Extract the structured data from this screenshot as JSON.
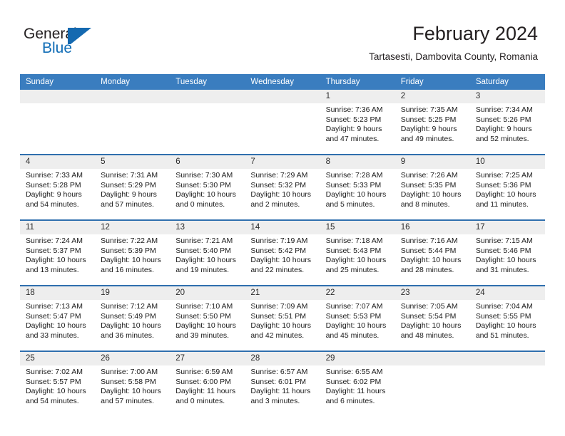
{
  "brand": {
    "name_part1": "General",
    "name_part2": "Blue",
    "mark": "triangle-logo",
    "accent_color": "#1469b0"
  },
  "header": {
    "title": "February 2024",
    "subtitle": "Tartasesti, Dambovita County, Romania"
  },
  "theme": {
    "header_blue": "#3a7dbf",
    "rule_blue": "#2f6fae",
    "daynum_band": "#eeeeee"
  },
  "weekdays": [
    "Sunday",
    "Monday",
    "Tuesday",
    "Wednesday",
    "Thursday",
    "Friday",
    "Saturday"
  ],
  "weeks": [
    {
      "days": [
        {
          "num": "",
          "empty": true
        },
        {
          "num": "",
          "empty": true
        },
        {
          "num": "",
          "empty": true
        },
        {
          "num": "",
          "empty": true
        },
        {
          "num": "1",
          "sunrise": "Sunrise: 7:36 AM",
          "sunset": "Sunset: 5:23 PM",
          "daylight1": "Daylight: 9 hours",
          "daylight2": "and 47 minutes."
        },
        {
          "num": "2",
          "sunrise": "Sunrise: 7:35 AM",
          "sunset": "Sunset: 5:25 PM",
          "daylight1": "Daylight: 9 hours",
          "daylight2": "and 49 minutes."
        },
        {
          "num": "3",
          "sunrise": "Sunrise: 7:34 AM",
          "sunset": "Sunset: 5:26 PM",
          "daylight1": "Daylight: 9 hours",
          "daylight2": "and 52 minutes."
        }
      ]
    },
    {
      "days": [
        {
          "num": "4",
          "sunrise": "Sunrise: 7:33 AM",
          "sunset": "Sunset: 5:28 PM",
          "daylight1": "Daylight: 9 hours",
          "daylight2": "and 54 minutes."
        },
        {
          "num": "5",
          "sunrise": "Sunrise: 7:31 AM",
          "sunset": "Sunset: 5:29 PM",
          "daylight1": "Daylight: 9 hours",
          "daylight2": "and 57 minutes."
        },
        {
          "num": "6",
          "sunrise": "Sunrise: 7:30 AM",
          "sunset": "Sunset: 5:30 PM",
          "daylight1": "Daylight: 10 hours",
          "daylight2": "and 0 minutes."
        },
        {
          "num": "7",
          "sunrise": "Sunrise: 7:29 AM",
          "sunset": "Sunset: 5:32 PM",
          "daylight1": "Daylight: 10 hours",
          "daylight2": "and 2 minutes."
        },
        {
          "num": "8",
          "sunrise": "Sunrise: 7:28 AM",
          "sunset": "Sunset: 5:33 PM",
          "daylight1": "Daylight: 10 hours",
          "daylight2": "and 5 minutes."
        },
        {
          "num": "9",
          "sunrise": "Sunrise: 7:26 AM",
          "sunset": "Sunset: 5:35 PM",
          "daylight1": "Daylight: 10 hours",
          "daylight2": "and 8 minutes."
        },
        {
          "num": "10",
          "sunrise": "Sunrise: 7:25 AM",
          "sunset": "Sunset: 5:36 PM",
          "daylight1": "Daylight: 10 hours",
          "daylight2": "and 11 minutes."
        }
      ]
    },
    {
      "days": [
        {
          "num": "11",
          "sunrise": "Sunrise: 7:24 AM",
          "sunset": "Sunset: 5:37 PM",
          "daylight1": "Daylight: 10 hours",
          "daylight2": "and 13 minutes."
        },
        {
          "num": "12",
          "sunrise": "Sunrise: 7:22 AM",
          "sunset": "Sunset: 5:39 PM",
          "daylight1": "Daylight: 10 hours",
          "daylight2": "and 16 minutes."
        },
        {
          "num": "13",
          "sunrise": "Sunrise: 7:21 AM",
          "sunset": "Sunset: 5:40 PM",
          "daylight1": "Daylight: 10 hours",
          "daylight2": "and 19 minutes."
        },
        {
          "num": "14",
          "sunrise": "Sunrise: 7:19 AM",
          "sunset": "Sunset: 5:42 PM",
          "daylight1": "Daylight: 10 hours",
          "daylight2": "and 22 minutes."
        },
        {
          "num": "15",
          "sunrise": "Sunrise: 7:18 AM",
          "sunset": "Sunset: 5:43 PM",
          "daylight1": "Daylight: 10 hours",
          "daylight2": "and 25 minutes."
        },
        {
          "num": "16",
          "sunrise": "Sunrise: 7:16 AM",
          "sunset": "Sunset: 5:44 PM",
          "daylight1": "Daylight: 10 hours",
          "daylight2": "and 28 minutes."
        },
        {
          "num": "17",
          "sunrise": "Sunrise: 7:15 AM",
          "sunset": "Sunset: 5:46 PM",
          "daylight1": "Daylight: 10 hours",
          "daylight2": "and 31 minutes."
        }
      ]
    },
    {
      "days": [
        {
          "num": "18",
          "sunrise": "Sunrise: 7:13 AM",
          "sunset": "Sunset: 5:47 PM",
          "daylight1": "Daylight: 10 hours",
          "daylight2": "and 33 minutes."
        },
        {
          "num": "19",
          "sunrise": "Sunrise: 7:12 AM",
          "sunset": "Sunset: 5:49 PM",
          "daylight1": "Daylight: 10 hours",
          "daylight2": "and 36 minutes."
        },
        {
          "num": "20",
          "sunrise": "Sunrise: 7:10 AM",
          "sunset": "Sunset: 5:50 PM",
          "daylight1": "Daylight: 10 hours",
          "daylight2": "and 39 minutes."
        },
        {
          "num": "21",
          "sunrise": "Sunrise: 7:09 AM",
          "sunset": "Sunset: 5:51 PM",
          "daylight1": "Daylight: 10 hours",
          "daylight2": "and 42 minutes."
        },
        {
          "num": "22",
          "sunrise": "Sunrise: 7:07 AM",
          "sunset": "Sunset: 5:53 PM",
          "daylight1": "Daylight: 10 hours",
          "daylight2": "and 45 minutes."
        },
        {
          "num": "23",
          "sunrise": "Sunrise: 7:05 AM",
          "sunset": "Sunset: 5:54 PM",
          "daylight1": "Daylight: 10 hours",
          "daylight2": "and 48 minutes."
        },
        {
          "num": "24",
          "sunrise": "Sunrise: 7:04 AM",
          "sunset": "Sunset: 5:55 PM",
          "daylight1": "Daylight: 10 hours",
          "daylight2": "and 51 minutes."
        }
      ]
    },
    {
      "days": [
        {
          "num": "25",
          "sunrise": "Sunrise: 7:02 AM",
          "sunset": "Sunset: 5:57 PM",
          "daylight1": "Daylight: 10 hours",
          "daylight2": "and 54 minutes."
        },
        {
          "num": "26",
          "sunrise": "Sunrise: 7:00 AM",
          "sunset": "Sunset: 5:58 PM",
          "daylight1": "Daylight: 10 hours",
          "daylight2": "and 57 minutes."
        },
        {
          "num": "27",
          "sunrise": "Sunrise: 6:59 AM",
          "sunset": "Sunset: 6:00 PM",
          "daylight1": "Daylight: 11 hours",
          "daylight2": "and 0 minutes."
        },
        {
          "num": "28",
          "sunrise": "Sunrise: 6:57 AM",
          "sunset": "Sunset: 6:01 PM",
          "daylight1": "Daylight: 11 hours",
          "daylight2": "and 3 minutes."
        },
        {
          "num": "29",
          "sunrise": "Sunrise: 6:55 AM",
          "sunset": "Sunset: 6:02 PM",
          "daylight1": "Daylight: 11 hours",
          "daylight2": "and 6 minutes."
        },
        {
          "num": "",
          "empty": true
        },
        {
          "num": "",
          "empty": true
        }
      ]
    }
  ]
}
